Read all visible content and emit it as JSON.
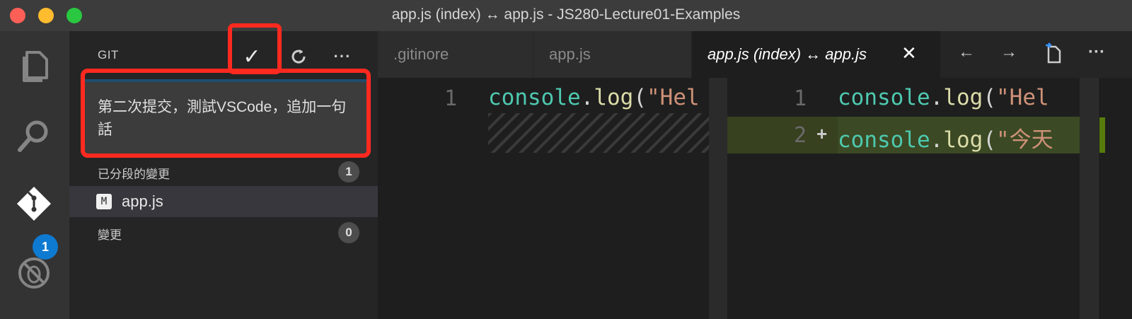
{
  "window": {
    "title": "app.js (index) ↔ app.js - JS280-Lecture01-Examples"
  },
  "activity": {
    "explorer_icon": "files-icon",
    "search_icon": "search-icon",
    "git_icon": "git-icon",
    "git_badge": "1",
    "debug_icon": "debug-icon"
  },
  "sidebar": {
    "title": "GIT",
    "commit_icon": "check-icon",
    "commit_glyph": "✓",
    "refresh_icon": "refresh-icon",
    "more_glyph": "···",
    "commit_message": "第二次提交，測試VSCode，追加一句話",
    "staged": {
      "label": "已分段的變更",
      "count": "1"
    },
    "files": [
      {
        "status": "M",
        "name": "app.js"
      }
    ],
    "changes": {
      "label": "變更",
      "count": "0"
    }
  },
  "tabs": [
    {
      "label": ".gitinore",
      "active": false
    },
    {
      "label": "app.js",
      "active": false
    },
    {
      "label": "app.js (index) ↔ app.js",
      "active": true,
      "close": "✕"
    }
  ],
  "toolbar": {
    "prev": "←",
    "next": "→",
    "open_file_icon": "open-file-icon",
    "more": "···"
  },
  "left_editor": {
    "lines": [
      {
        "num": "1",
        "obj": "console",
        "dot": ".",
        "fn": "log",
        "paren": "(",
        "str": "\"Hel"
      }
    ]
  },
  "right_editor": {
    "lines": [
      {
        "num": "1",
        "obj": "console",
        "dot": ".",
        "fn": "log",
        "paren": "(",
        "str": "\"Hel"
      },
      {
        "num": "2",
        "marker": "+",
        "obj": "console",
        "dot": ".",
        "fn": "log",
        "paren": "(",
        "str": "\"今天"
      }
    ]
  },
  "colors": {
    "highlight_box": "#ff2a1f",
    "badge": "#0e7ad1",
    "added_line": "#3b4a24"
  }
}
